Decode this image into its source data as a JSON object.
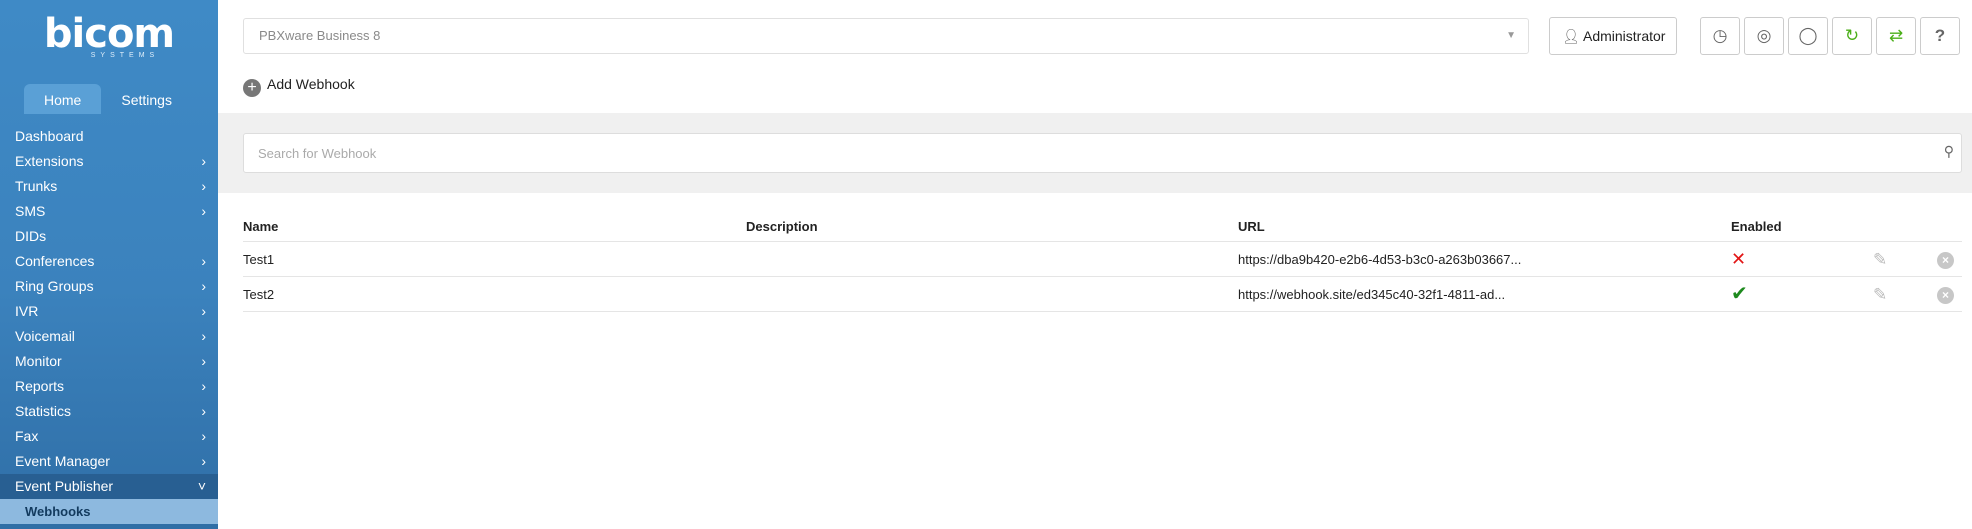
{
  "sidebar": {
    "logo": {
      "brand": "bicom",
      "sub": "SYSTEMS"
    },
    "tabs": [
      {
        "label": "Home"
      },
      {
        "label": "Settings"
      }
    ],
    "items": [
      {
        "label": "Dashboard"
      },
      {
        "label": "Extensions"
      },
      {
        "label": "Trunks"
      },
      {
        "label": "SMS"
      },
      {
        "label": "DIDs"
      },
      {
        "label": "Conferences"
      },
      {
        "label": "Ring Groups"
      },
      {
        "label": "IVR"
      },
      {
        "label": "Voicemail"
      },
      {
        "label": "Monitor"
      },
      {
        "label": "Reports"
      },
      {
        "label": "Statistics"
      },
      {
        "label": "Fax"
      },
      {
        "label": "Event Manager"
      },
      {
        "label": "Event Publisher"
      },
      {
        "label": "Webhooks"
      }
    ]
  },
  "topbar": {
    "server_select": "PBXware Business 8",
    "user_label": "Administrator",
    "icons": [
      "clock-icon",
      "support-icon",
      "globe-icon",
      "refresh-icon",
      "sync-icon",
      "help-icon"
    ]
  },
  "toolbar": {
    "add_label": "Add Webhook"
  },
  "search": {
    "placeholder": "Search for Webhook",
    "value": ""
  },
  "table": {
    "headers": {
      "name": "Name",
      "description": "Description",
      "url": "URL",
      "enabled": "Enabled"
    },
    "rows": [
      {
        "name": "Test1",
        "description": "",
        "url": "https://dba9b420-e2b6-4d53-b3c0-a263b03667...",
        "enabled": false
      },
      {
        "name": "Test2",
        "description": "",
        "url": "https://webhook.site/ed345c40-32f1-4811-ad...",
        "enabled": true
      }
    ]
  },
  "colors": {
    "sidebar": "#3b82bd",
    "accent_green": "#4caf1a",
    "disabled_red": "#e21515",
    "enabled_green": "#1e8a1e"
  }
}
